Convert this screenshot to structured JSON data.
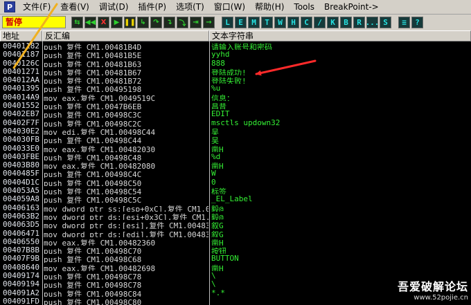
{
  "menubar": {
    "app_icon_glyph": "P",
    "items": [
      "文件(F)",
      "查看(V)",
      "调试(D)",
      "插件(P)",
      "选项(T)",
      "窗口(W)",
      "帮助(H)",
      "Tools",
      "BreakPoint->"
    ]
  },
  "toolbar": {
    "status": "暂停",
    "control_buttons": [
      {
        "icon": "open-icon",
        "glyph": "⇆",
        "tone": ""
      },
      {
        "icon": "restart-icon",
        "glyph": "◀◀",
        "tone": ""
      },
      {
        "icon": "close-icon",
        "glyph": "X",
        "tone": "red"
      },
      {
        "icon": "run-icon",
        "glyph": "▶",
        "tone": ""
      },
      {
        "icon": "pause-icon",
        "glyph": "❚❚",
        "tone": "yellow"
      },
      {
        "icon": "step-into-icon",
        "glyph": "↳",
        "tone": ""
      },
      {
        "icon": "step-over-icon",
        "glyph": "↷",
        "tone": ""
      },
      {
        "icon": "trace-into-icon",
        "glyph": "↴",
        "tone": ""
      },
      {
        "icon": "trace-over-icon",
        "glyph": "⤵",
        "tone": ""
      },
      {
        "icon": "execute-till-return-icon",
        "glyph": "⇥",
        "tone": ""
      },
      {
        "icon": "goto-icon",
        "glyph": "→",
        "tone": ""
      }
    ],
    "letter_buttons": [
      "L",
      "E",
      "M",
      "T",
      "W",
      "H",
      "C",
      "/",
      "K",
      "B",
      "R",
      "...",
      "S"
    ],
    "extra_buttons": [
      {
        "icon": "list-icon",
        "glyph": "≡"
      },
      {
        "icon": "help-icon",
        "glyph": "?"
      }
    ]
  },
  "columns": {
    "address": "地址",
    "disasm": "反汇编",
    "text": "文本字符串"
  },
  "rows": [
    {
      "addr": "00401182",
      "disasm": "push 复件_CM1.00481B4D",
      "text": "请输入账号和密码"
    },
    {
      "addr": "00401187",
      "disasm": "push 复件_CM1.00481B5E",
      "text": "yyhd"
    },
    {
      "addr": "0040126C",
      "disasm": "push 复件_CM1.00481B63",
      "text": "888"
    },
    {
      "addr": "00401271",
      "disasm": "push 复件_CM1.00481B67",
      "text": "登陆成功!"
    },
    {
      "addr": "004012AA",
      "disasm": "push 复件_CM1.00481B72",
      "text": "登陆失败!"
    },
    {
      "addr": "00401395",
      "disasm": "push 复件_CM1.00495198",
      "text": "%u"
    },
    {
      "addr": "004014A9",
      "disasm": "mov eax,复件_CM1.0049519C",
      "text": "信息："
    },
    {
      "addr": "00401552",
      "disasm": "push 复件_CM1.0047B6EB",
      "text": "昌昔"
    },
    {
      "addr": "00402EB7",
      "disasm": "push 复件_CM1.00498C3C",
      "text": "EDIT"
    },
    {
      "addr": "00402F7F",
      "disasm": "push 复件_CM1.00498C2C",
      "text": "msctls_updown32"
    },
    {
      "addr": "004030E2",
      "disasm": "mov edi,复件_CM1.00498C44",
      "text": "吴"
    },
    {
      "addr": "004030FB",
      "disasm": "push 复件_CM1.00498C44",
      "text": "吴"
    },
    {
      "addr": "004033E0",
      "disasm": "mov eax,复件_CM1.00482030",
      "text": "凿H"
    },
    {
      "addr": "00403FBE",
      "disasm": "push 复件_CM1.00498C48",
      "text": "%d"
    },
    {
      "addr": "00403B80",
      "disasm": "mov eax,复件_CM1.00482080",
      "text": "凿H"
    },
    {
      "addr": "0040485F",
      "disasm": "push 复件_CM1.00498C4C",
      "text": "W"
    },
    {
      "addr": "00404D1C",
      "disasm": "push 复件_CM1.00498C50",
      "text": "0"
    },
    {
      "addr": "004053A5",
      "disasm": "push 复件_CM1.00498C54",
      "text": "标签"
    },
    {
      "addr": "004059A8",
      "disasm": "push 复件_CM1.00498C5C",
      "text": "_EL_Label"
    },
    {
      "addr": "00406163",
      "disasm": "mov dword ptr ss:[esp+0xC],复件_CM1.00483A6C",
      "text": "毅@"
    },
    {
      "addr": "004063B2",
      "disasm": "mov dword ptr ds:[esi+0x3C],复件_CM1.00483A68",
      "text": "毅@"
    },
    {
      "addr": "004063D5",
      "disasm": "mov dword ptr ds:[esi],复件_CM1.00483A60",
      "text": "叙G"
    },
    {
      "addr": "00406471",
      "disasm": "mov dword ptr ds:[edi],复件_CM1.00483A60",
      "text": "叙G"
    },
    {
      "addr": "00406550",
      "disasm": "mov eax,复件_CM1.00482360",
      "text": "凿H"
    },
    {
      "addr": "00407B8B",
      "disasm": "push 复件_CM1.00498C70",
      "text": "按钮"
    },
    {
      "addr": "00407F9B",
      "disasm": "push 复件_CM1.00498C68",
      "text": "BUTTON"
    },
    {
      "addr": "00408640",
      "disasm": "mov eax,复件_CM1.00482698",
      "text": "凿H"
    },
    {
      "addr": "00409174",
      "disasm": "push 复件_CM1.00498C78",
      "text": "\\"
    },
    {
      "addr": "00409194",
      "disasm": "push 复件_CM1.00498C78",
      "text": "\\"
    },
    {
      "addr": "004091A2",
      "disasm": "push 复件_CM1.00498C84",
      "text": "*.*"
    },
    {
      "addr": "004091FD",
      "disasm": "push 复件_CM1.00498C80",
      "text": ""
    },
    {
      "addr": "00409253",
      "disasm": "push 复件_CM1.00498C80",
      "text": ""
    }
  ],
  "watermark": {
    "title": "吾爱破解论坛",
    "url": "www.52pojie.cn"
  },
  "annotations": {
    "arrow_color": "#ff2a2a",
    "highlight_color": "#f0b020"
  }
}
